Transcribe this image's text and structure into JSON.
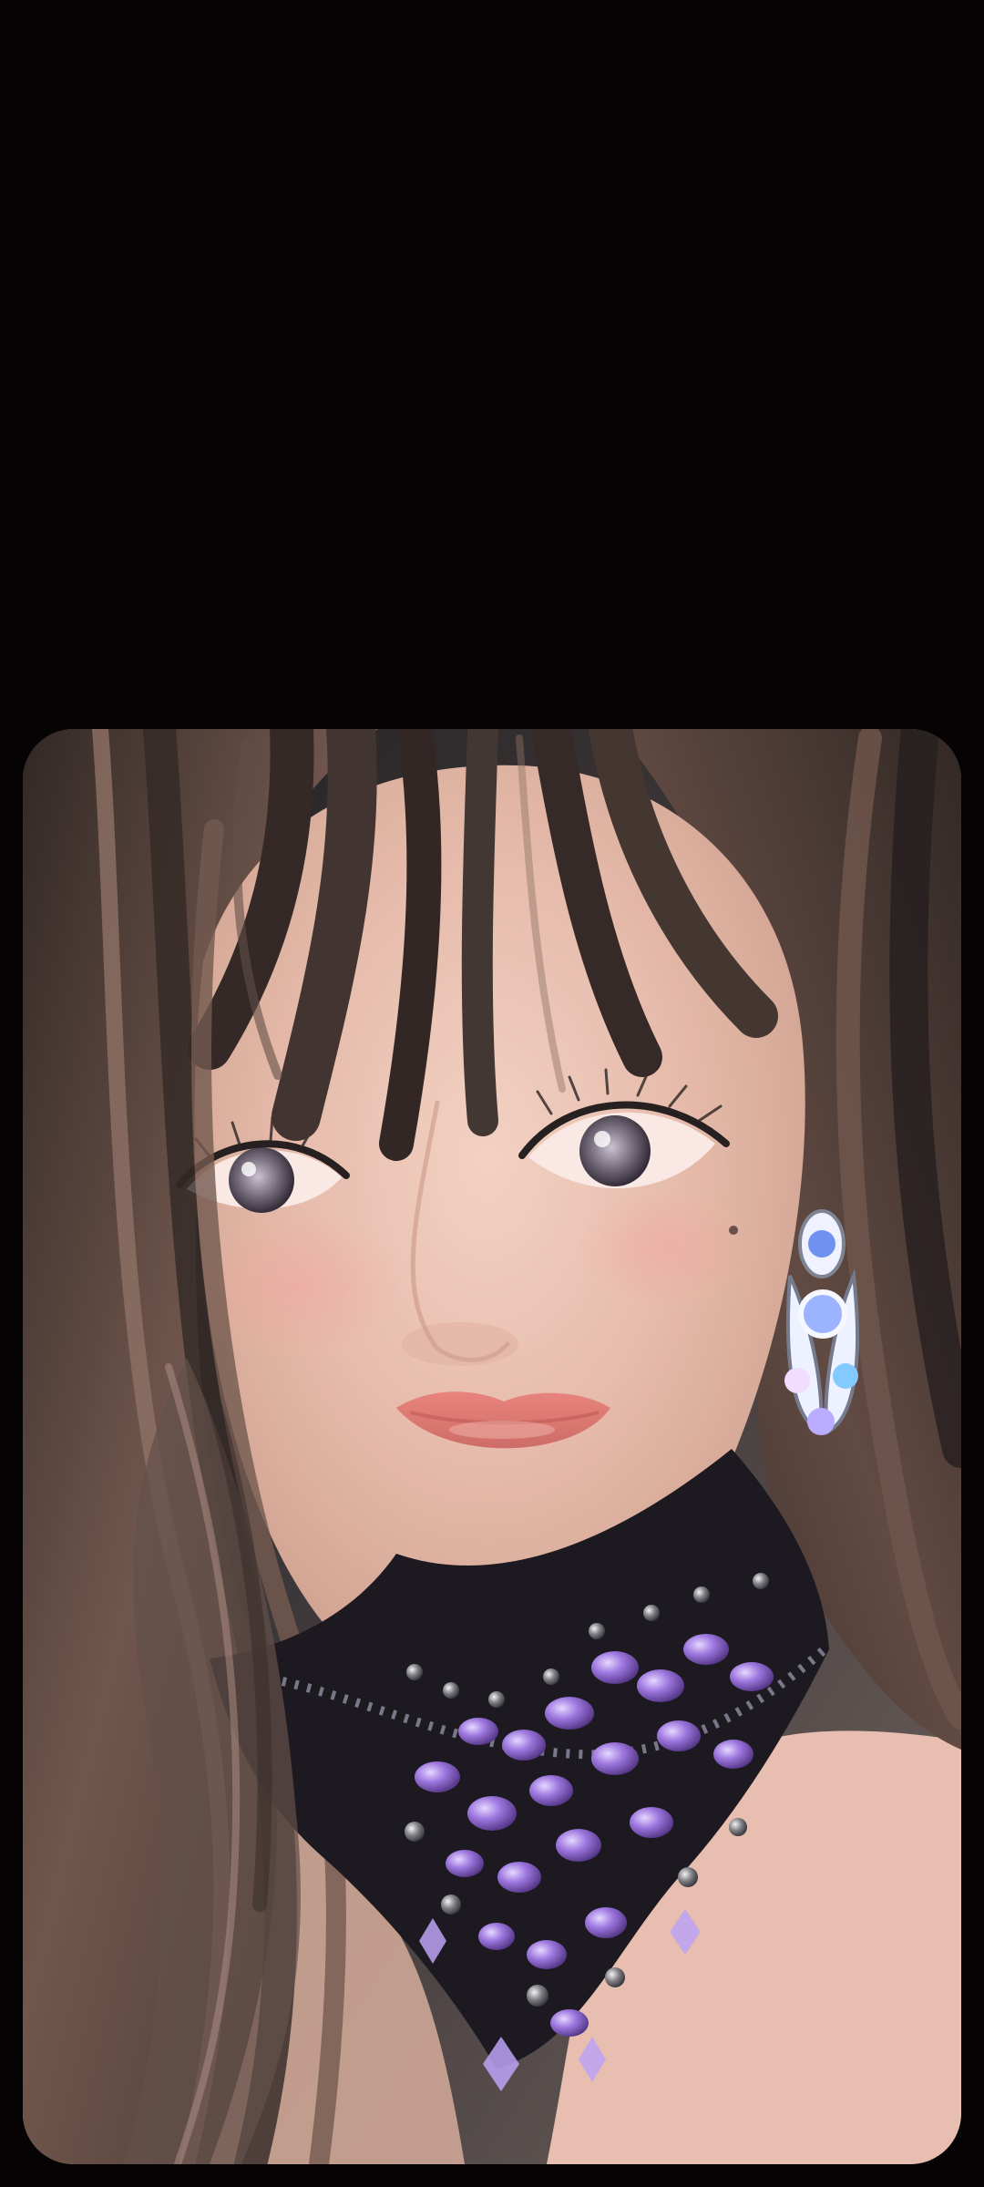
{
  "photo": {
    "alt": ""
  },
  "colors": {
    "background": "#050304",
    "skin": "#e8c3b2",
    "hair": "#4a3a33",
    "necklace": "#8a63c5",
    "lips": "#d97d74"
  },
  "icons": {
    "photo": "portrait-photo"
  }
}
